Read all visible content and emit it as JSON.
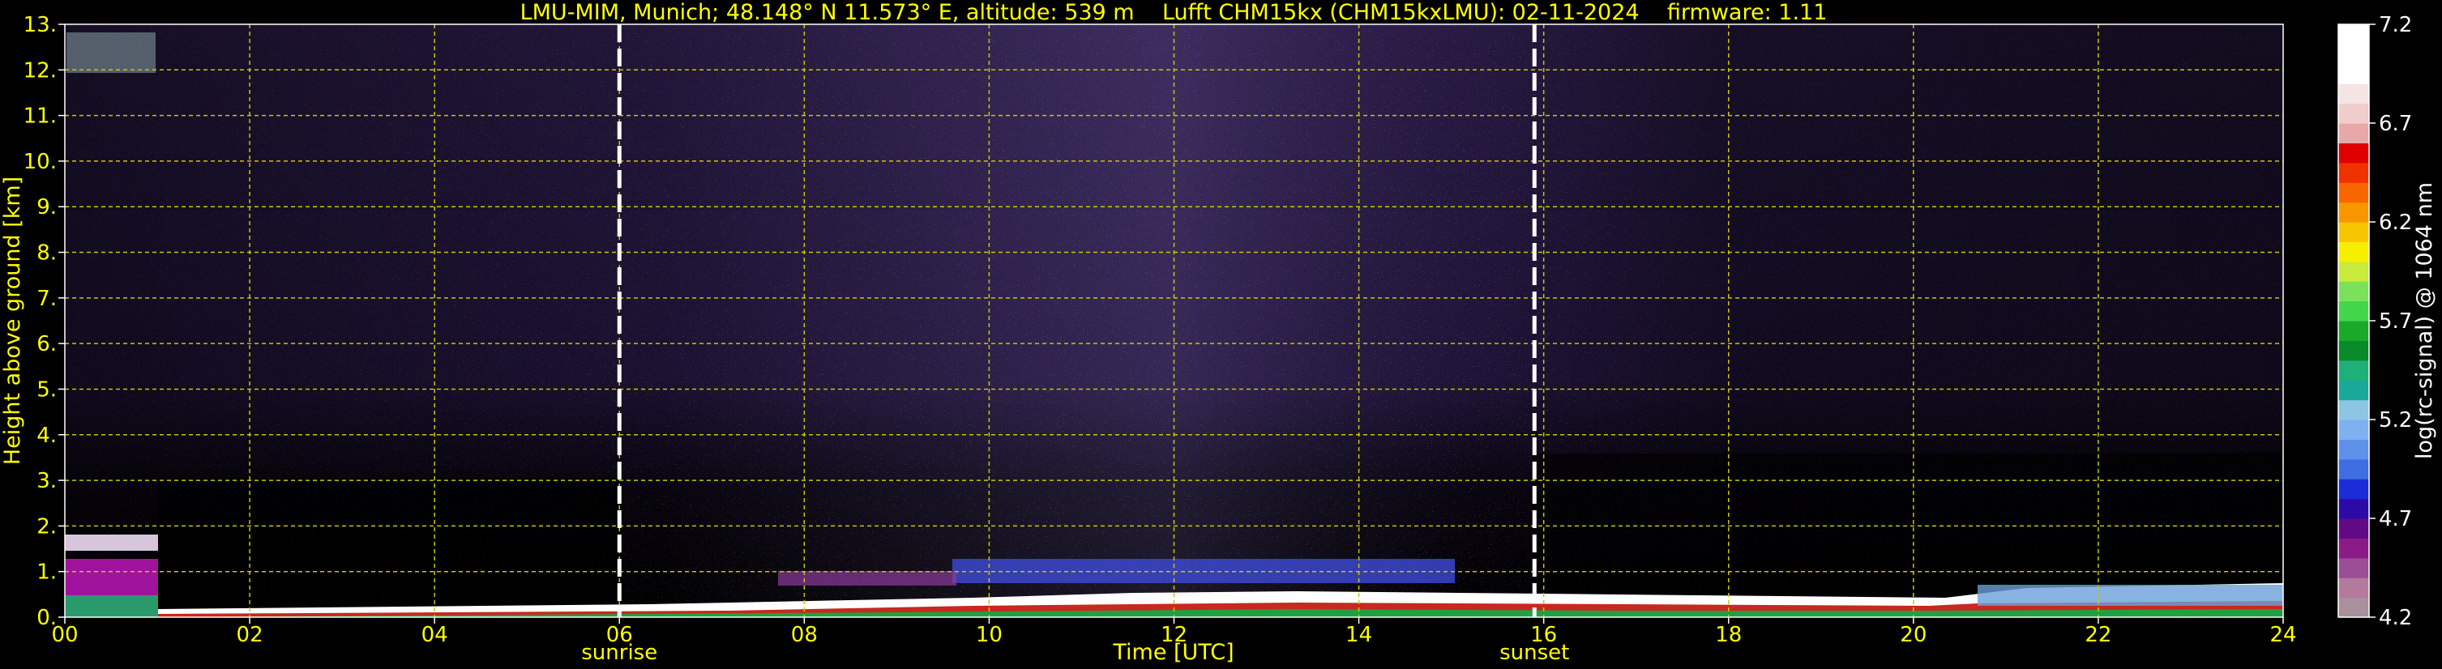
{
  "chart_data": {
    "type": "heatmap",
    "title": "LMU-MIM, Munich; 48.148° N 11.573° E, altitude: 539 m    Lufft CHM15kx (CHM15kxLMU): 02-11-2024    firmware: 1.11",
    "xlabel": "Time [UTC]",
    "ylabel": "Height above ground [km]",
    "colorbar_label": "log(rc-signal) @ 1064 nm",
    "xlim": [
      0,
      24
    ],
    "ylim": [
      0,
      13
    ],
    "x_ticks": [
      "00",
      "02",
      "04",
      "06",
      "08",
      "10",
      "12",
      "14",
      "16",
      "18",
      "20",
      "22",
      "24"
    ],
    "y_ticks": [
      "0.",
      "1.",
      "2.",
      "3.",
      "4.",
      "5.",
      "6.",
      "7.",
      "8.",
      "9.",
      "10.",
      "11.",
      "12.",
      "13."
    ],
    "colorbar_ticks": [
      "4.2",
      "4.7",
      "5.2",
      "5.7",
      "6.2",
      "6.7",
      "7.2"
    ],
    "colorbar_range": [
      4.2,
      7.2
    ],
    "grid": true,
    "markers": [
      {
        "name": "sunrise",
        "x": 6.0
      },
      {
        "name": "sunset",
        "x": 15.9
      }
    ],
    "colors": {
      "text": "#ffff00",
      "grid": "#c8c800",
      "marker_line": "#ffffff",
      "colorbar_text": "#ffffff"
    }
  }
}
